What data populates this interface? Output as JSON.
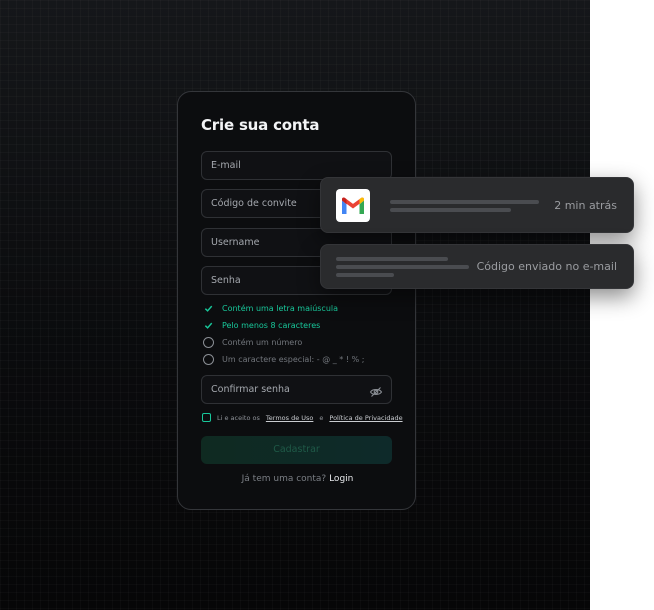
{
  "signup": {
    "title": "Crie sua conta",
    "fields": {
      "email": "E-mail",
      "invite": "Código de convite",
      "username": "Username",
      "password": "Senha",
      "confirm": "Confirmar senha"
    },
    "requirements": [
      {
        "text": "Contém uma letra maiúscula",
        "met": true
      },
      {
        "text": "Pelo menos 8 caracteres",
        "met": true
      },
      {
        "text": "Contém um número",
        "met": false
      },
      {
        "text": "Um caractere especial: - @ _ * ! % ;",
        "met": false
      }
    ],
    "terms": {
      "prefix": "Li e aceito os",
      "terms_link": "Termos de Uso",
      "and": "e",
      "privacy_link": "Política de Privacidade"
    },
    "submit_label": "Cadastrar",
    "login_prompt": "Já tem uma conta?",
    "login_link": "Login"
  },
  "notifications": [
    {
      "icon": "gmail-icon",
      "time": "2 min atrás"
    },
    {
      "text": "Código enviado no e-mail"
    }
  ],
  "colors": {
    "accent": "#18c79a",
    "background": "#0b0c0e",
    "toast": "#2a2b2d"
  }
}
